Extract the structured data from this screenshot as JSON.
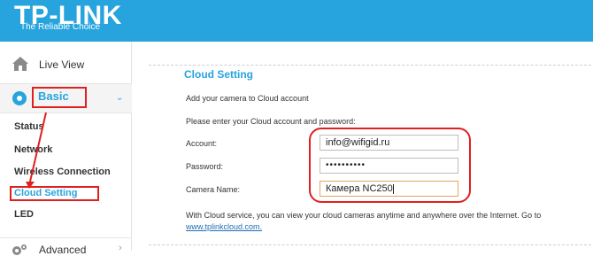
{
  "header": {
    "logo": "TP-LINK",
    "tagline": "The Reliable Choice",
    "bg_color": "#27a4dd"
  },
  "sidebar": {
    "live_view": {
      "label": "Live View",
      "icon": "home-icon"
    },
    "basic": {
      "label": "Basic",
      "icon": "basic-settings-icon",
      "expanded": true
    },
    "basic_items": [
      {
        "label": "Status"
      },
      {
        "label": "Network"
      },
      {
        "label": "Wireless Connection"
      },
      {
        "label": "Cloud Setting",
        "active": true
      },
      {
        "label": "LED"
      }
    ],
    "advanced": {
      "label": "Advanced",
      "icon": "gear-icon"
    }
  },
  "main": {
    "title": "Cloud Setting",
    "intro": "Add your camera to Cloud account",
    "prompt": "Please enter your Cloud account and password:",
    "fields": {
      "account": {
        "label": "Account:",
        "value": "info@wifigid.ru"
      },
      "password": {
        "label": "Password:",
        "value": "••••••••••"
      },
      "camera_name": {
        "label": "Camera Name:",
        "value": "Камера NC250"
      }
    },
    "footer_text": "With Cloud service, you can view your cloud cameras anytime and anywhere over the Internet. Go to",
    "footer_link": "www.tplinkcloud.com."
  },
  "colors": {
    "accent": "#27a4dd",
    "annotation": "#e02020",
    "link": "#1f6fb5"
  }
}
